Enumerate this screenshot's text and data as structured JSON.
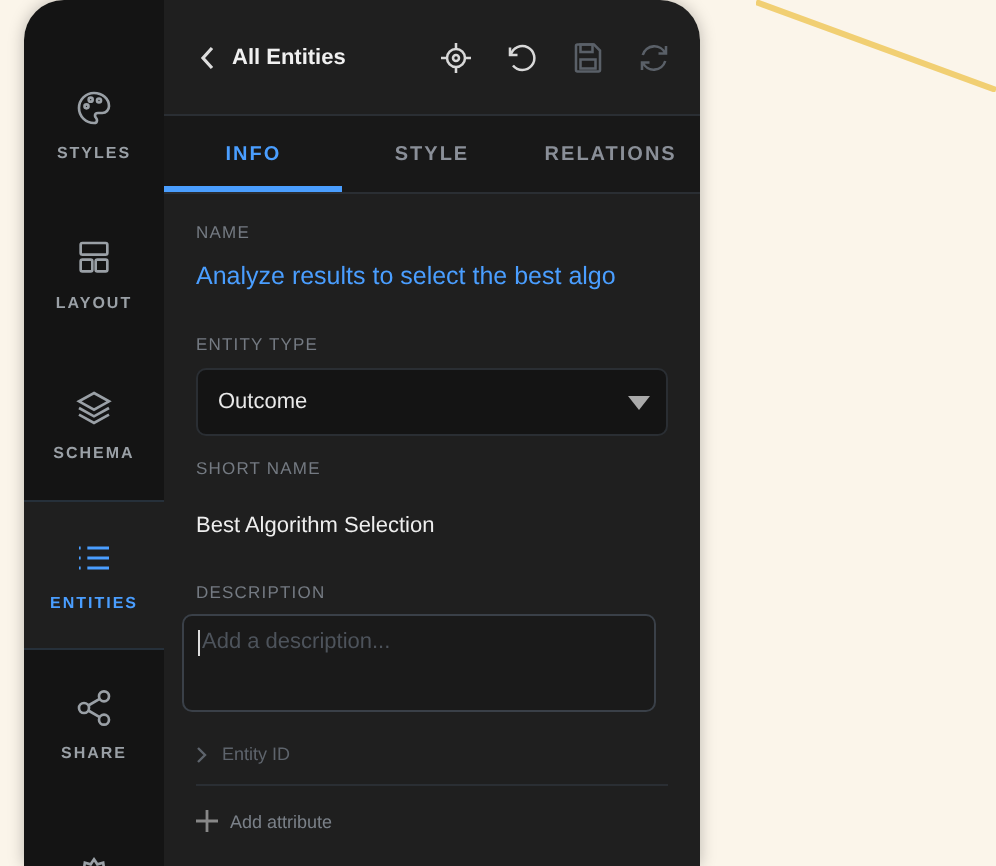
{
  "sidebar": {
    "items": [
      {
        "label": "STYLES",
        "selected": false
      },
      {
        "label": "LAYOUT",
        "selected": false
      },
      {
        "label": "SCHEMA",
        "selected": false
      },
      {
        "label": "ENTITIES",
        "selected": true
      },
      {
        "label": "SHARE",
        "selected": false
      },
      {
        "selected": false
      }
    ]
  },
  "header": {
    "back_label": "All Entities",
    "toolbar": [
      {
        "disabled": false
      },
      {
        "disabled": false
      },
      {
        "disabled": true
      },
      {
        "disabled": true
      }
    ]
  },
  "tabs": [
    {
      "label": "INFO",
      "selected": true
    },
    {
      "label": "STYLE",
      "selected": false
    },
    {
      "label": "RELATIONS",
      "selected": false
    }
  ],
  "form": {
    "name": {
      "label": "NAME",
      "value": "Analyze results to select the best algo"
    },
    "entity_type": {
      "label": "ENTITY TYPE",
      "value": "Outcome"
    },
    "short_name": {
      "label": "SHORT NAME",
      "value": "Best Algorithm Selection"
    },
    "description": {
      "label": "DESCRIPTION",
      "placeholder": "Add a description..."
    },
    "entity_id": {
      "label": "Entity ID",
      "expanded": false
    },
    "add_attribute": "Add attribute"
  }
}
